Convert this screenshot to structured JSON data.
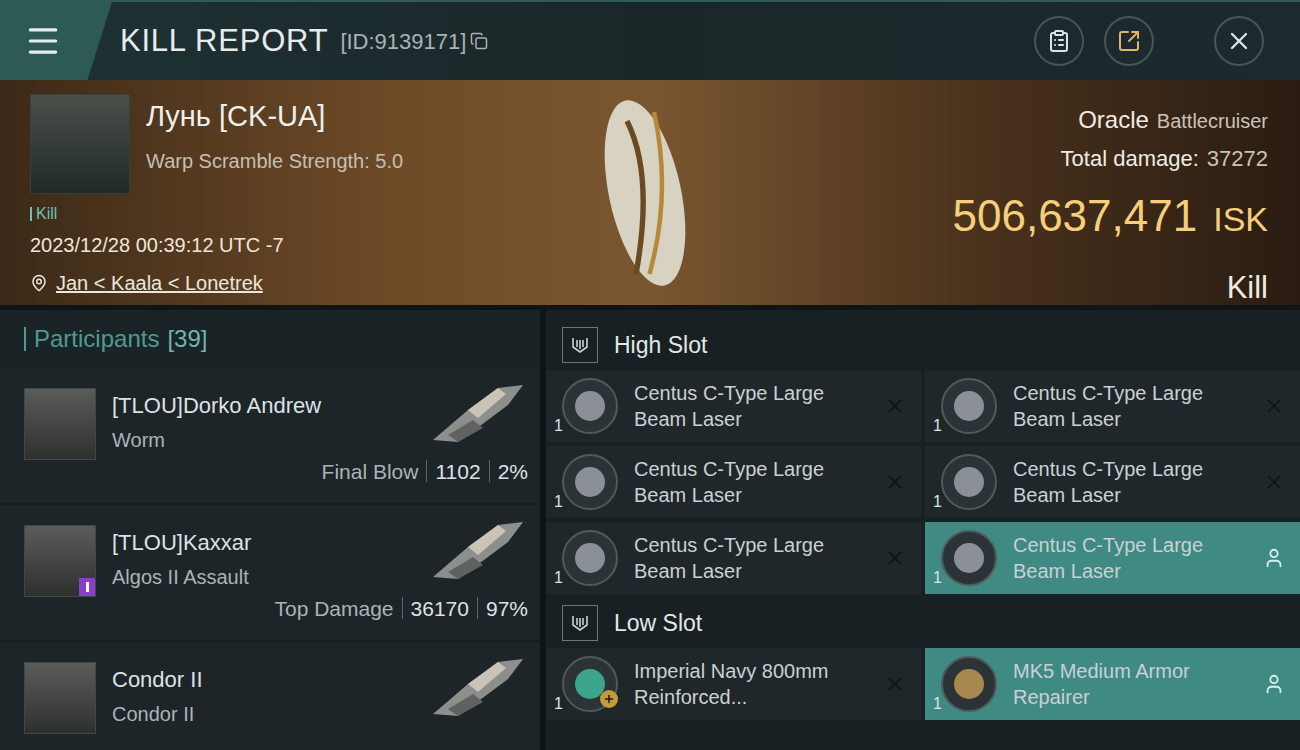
{
  "top_bar": {
    "title": "KILL REPORT",
    "id": "[ID:9139171]"
  },
  "victim": {
    "name": "Лунь [CK-UA]",
    "warp_scramble": "Warp Scramble Strength: 5.0",
    "tag": "Kill",
    "time": "2023/12/28 00:39:12 UTC -7",
    "location": "Jan < Kaala < Lonetrek"
  },
  "ship": {
    "name": "Oracle",
    "class": "Battlecruiser",
    "total_damage_label": "Total damage:",
    "total_damage": "37272",
    "value": "506,637,471",
    "currency": "ISK",
    "result": "Kill"
  },
  "participants": {
    "label": "Participants",
    "count": "[39]",
    "items": [
      {
        "name": "[TLOU]Dorko Andrew",
        "ship": "Worm",
        "stat_label": "Final Blow",
        "damage": "1102",
        "share": "2%",
        "badge": false
      },
      {
        "name": "[TLOU]Kaxxar",
        "ship": "Algos II Assault",
        "stat_label": "Top Damage",
        "damage": "36170",
        "share": "97%",
        "badge": true
      },
      {
        "name": "Condor II",
        "ship": "Condor II",
        "stat_label": "",
        "damage": "",
        "share": "",
        "badge": false
      }
    ]
  },
  "slots": [
    {
      "title": "High Slot",
      "items": [
        {
          "quantity": "1",
          "name": "Centus C-Type Large Beam Laser",
          "dropped": false,
          "plus_badge": false,
          "color": "#8a9095"
        },
        {
          "quantity": "1",
          "name": "Centus C-Type Large Beam Laser",
          "dropped": false,
          "plus_badge": false,
          "color": "#8a9095"
        },
        {
          "quantity": "1",
          "name": "Centus C-Type Large Beam Laser",
          "dropped": false,
          "plus_badge": false,
          "color": "#8a9095"
        },
        {
          "quantity": "1",
          "name": "Centus C-Type Large Beam Laser",
          "dropped": false,
          "plus_badge": false,
          "color": "#8a9095"
        },
        {
          "quantity": "1",
          "name": "Centus C-Type Large Beam Laser",
          "dropped": false,
          "plus_badge": false,
          "color": "#8a9095"
        },
        {
          "quantity": "1",
          "name": "Centus C-Type Large Beam Laser",
          "dropped": true,
          "plus_badge": false,
          "color": "#8a9095"
        }
      ]
    },
    {
      "title": "Low Slot",
      "items": [
        {
          "quantity": "1",
          "name": "Imperial Navy 800mm Reinforced...",
          "dropped": false,
          "plus_badge": true,
          "color": "#3aa58a"
        },
        {
          "quantity": "1",
          "name": "MK5 Medium Armor Repairer",
          "dropped": true,
          "plus_badge": false,
          "color": "#a8884e"
        }
      ]
    }
  ]
}
